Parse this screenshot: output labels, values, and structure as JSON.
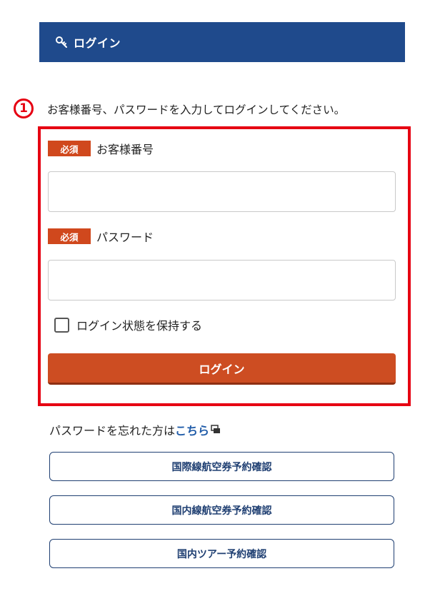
{
  "header": {
    "title": "ログイン",
    "icon": "key-icon",
    "bg_color": "#1f4a8c"
  },
  "instruction": {
    "marker": "1",
    "text": "お客様番号、パスワードを入力してログインしてください。"
  },
  "form": {
    "customer_number": {
      "required_badge": "必須",
      "label": "お客様番号",
      "value": "",
      "placeholder": ""
    },
    "password": {
      "required_badge": "必須",
      "label": "パスワード",
      "value": "",
      "placeholder": ""
    },
    "remember": {
      "label": "ログイン状態を保持する",
      "checked": false
    },
    "submit_label": "ログイン",
    "submit_color": "#cd4d22"
  },
  "forgot": {
    "text": "パスワードを忘れた方は",
    "link": "こちら",
    "icon": "external-window-icon"
  },
  "links": [
    {
      "label": "国際線航空券予約確認"
    },
    {
      "label": "国内線航空券予約確認"
    },
    {
      "label": "国内ツアー予約確認"
    }
  ]
}
